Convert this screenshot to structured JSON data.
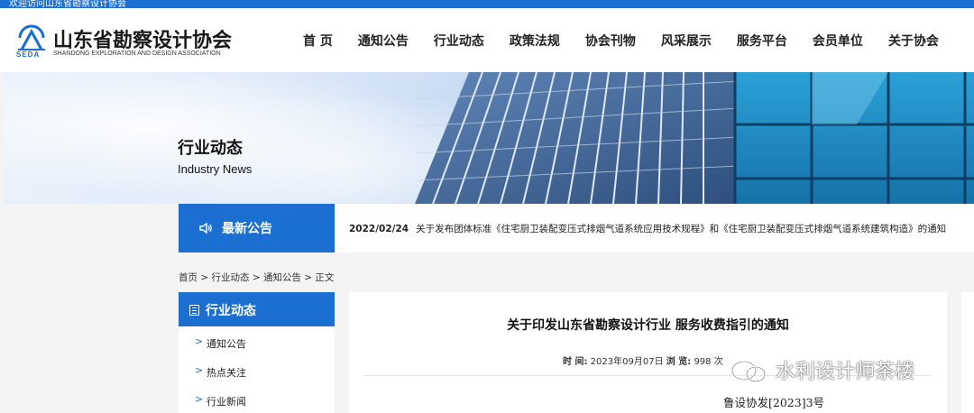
{
  "colors": {
    "brand": "#1b6fd0",
    "page_bg": "#f4f4f4"
  },
  "topbar": {
    "text": "欢迎访问山东省勘察设计协会"
  },
  "logo": {
    "icon": "seda-logo-icon",
    "abbr": "SEDA",
    "name": "山东省勘察设计协会",
    "english": "SHANDONG EXPLORATION AND DESIGN ASSOCIATION"
  },
  "nav": {
    "items": [
      {
        "label": "首 页"
      },
      {
        "label": "通知公告"
      },
      {
        "label": "行业动态"
      },
      {
        "label": "政策法规"
      },
      {
        "label": "协会刊物"
      },
      {
        "label": "风采展示"
      },
      {
        "label": "服务平台"
      },
      {
        "label": "会员单位"
      },
      {
        "label": "关于协会"
      }
    ]
  },
  "banner": {
    "title": "行业动态",
    "subtitle": "Industry News"
  },
  "notice": {
    "icon": "speaker-icon",
    "label": "最新公告",
    "date": "2022/02/24",
    "text": "关于发布团体标准《住宅厨卫装配变压式排烟气道系统应用技术规程》和《住宅厨卫装配变压式排烟气道系统建筑构造》的通知"
  },
  "breadcrumb": {
    "text": "首页 > 行业动态 > 通知公告 > 正文"
  },
  "sidebar": {
    "title": "行业动态",
    "icon": "document-icon",
    "items": [
      {
        "label": "通知公告"
      },
      {
        "label": "热点关注"
      },
      {
        "label": "行业新闻"
      }
    ]
  },
  "article": {
    "title": "关于印发山东省勘察设计行业 服务收费指引的通知",
    "time_label": "时 间:",
    "time_value": "2023年09月07日",
    "views_label": "浏 览:",
    "views_value": "998 次",
    "doc_number": "鲁设协发[2023]3号"
  },
  "watermark": {
    "icon": "wechat-icon",
    "text": "水利设计师茶楼"
  }
}
